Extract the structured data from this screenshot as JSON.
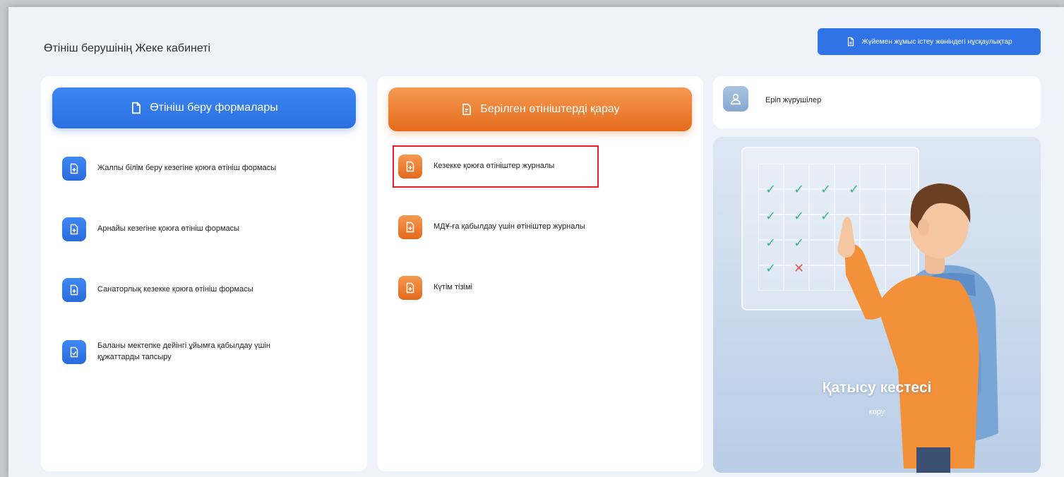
{
  "page": {
    "title": "Өтініш берушінің Жеке кабинеті",
    "guide_button": "Жүйемен жұмыс істеу жөніндегі нұсқаулықтар"
  },
  "forms_column": {
    "header": "Өтініш беру формалары",
    "items": [
      {
        "label": "Жалпы білім беру кезегіне қоюға өтініш формасы",
        "icon": "file-plus-icon"
      },
      {
        "label": "Арнайы кезегіне қоюға өтініш формасы",
        "icon": "file-plus-icon"
      },
      {
        "label": "Санаторлық кезекке қоюға өтініш формасы",
        "icon": "file-plus-icon"
      },
      {
        "label_line1": "Баланы мектепке дейінгі ұйымға қабылдау үшін",
        "label_line2": "құжаттарды тапсыру",
        "icon": "file-check-icon"
      }
    ]
  },
  "applications_column": {
    "header": "Берілген өтініштерді қарау",
    "items": [
      {
        "label": "Кезекке қоюға өтініштер журналы",
        "icon": "file-plus-icon",
        "highlighted": true
      },
      {
        "label": "МДҰ-ға қабылдау үшін өтініштер журналы",
        "icon": "file-plus-icon"
      },
      {
        "label": "Күтім тізімі",
        "icon": "file-plus-icon"
      }
    ]
  },
  "side": {
    "escort_label": "Еріп жүрушілер",
    "promo_title": "Қатысу кестесі",
    "promo_subtitle": "көру"
  },
  "colors": {
    "accent_blue": "#2f73e6",
    "accent_orange": "#e56b1c",
    "highlight_red": "#e0202a",
    "background": "#eef3f9"
  }
}
